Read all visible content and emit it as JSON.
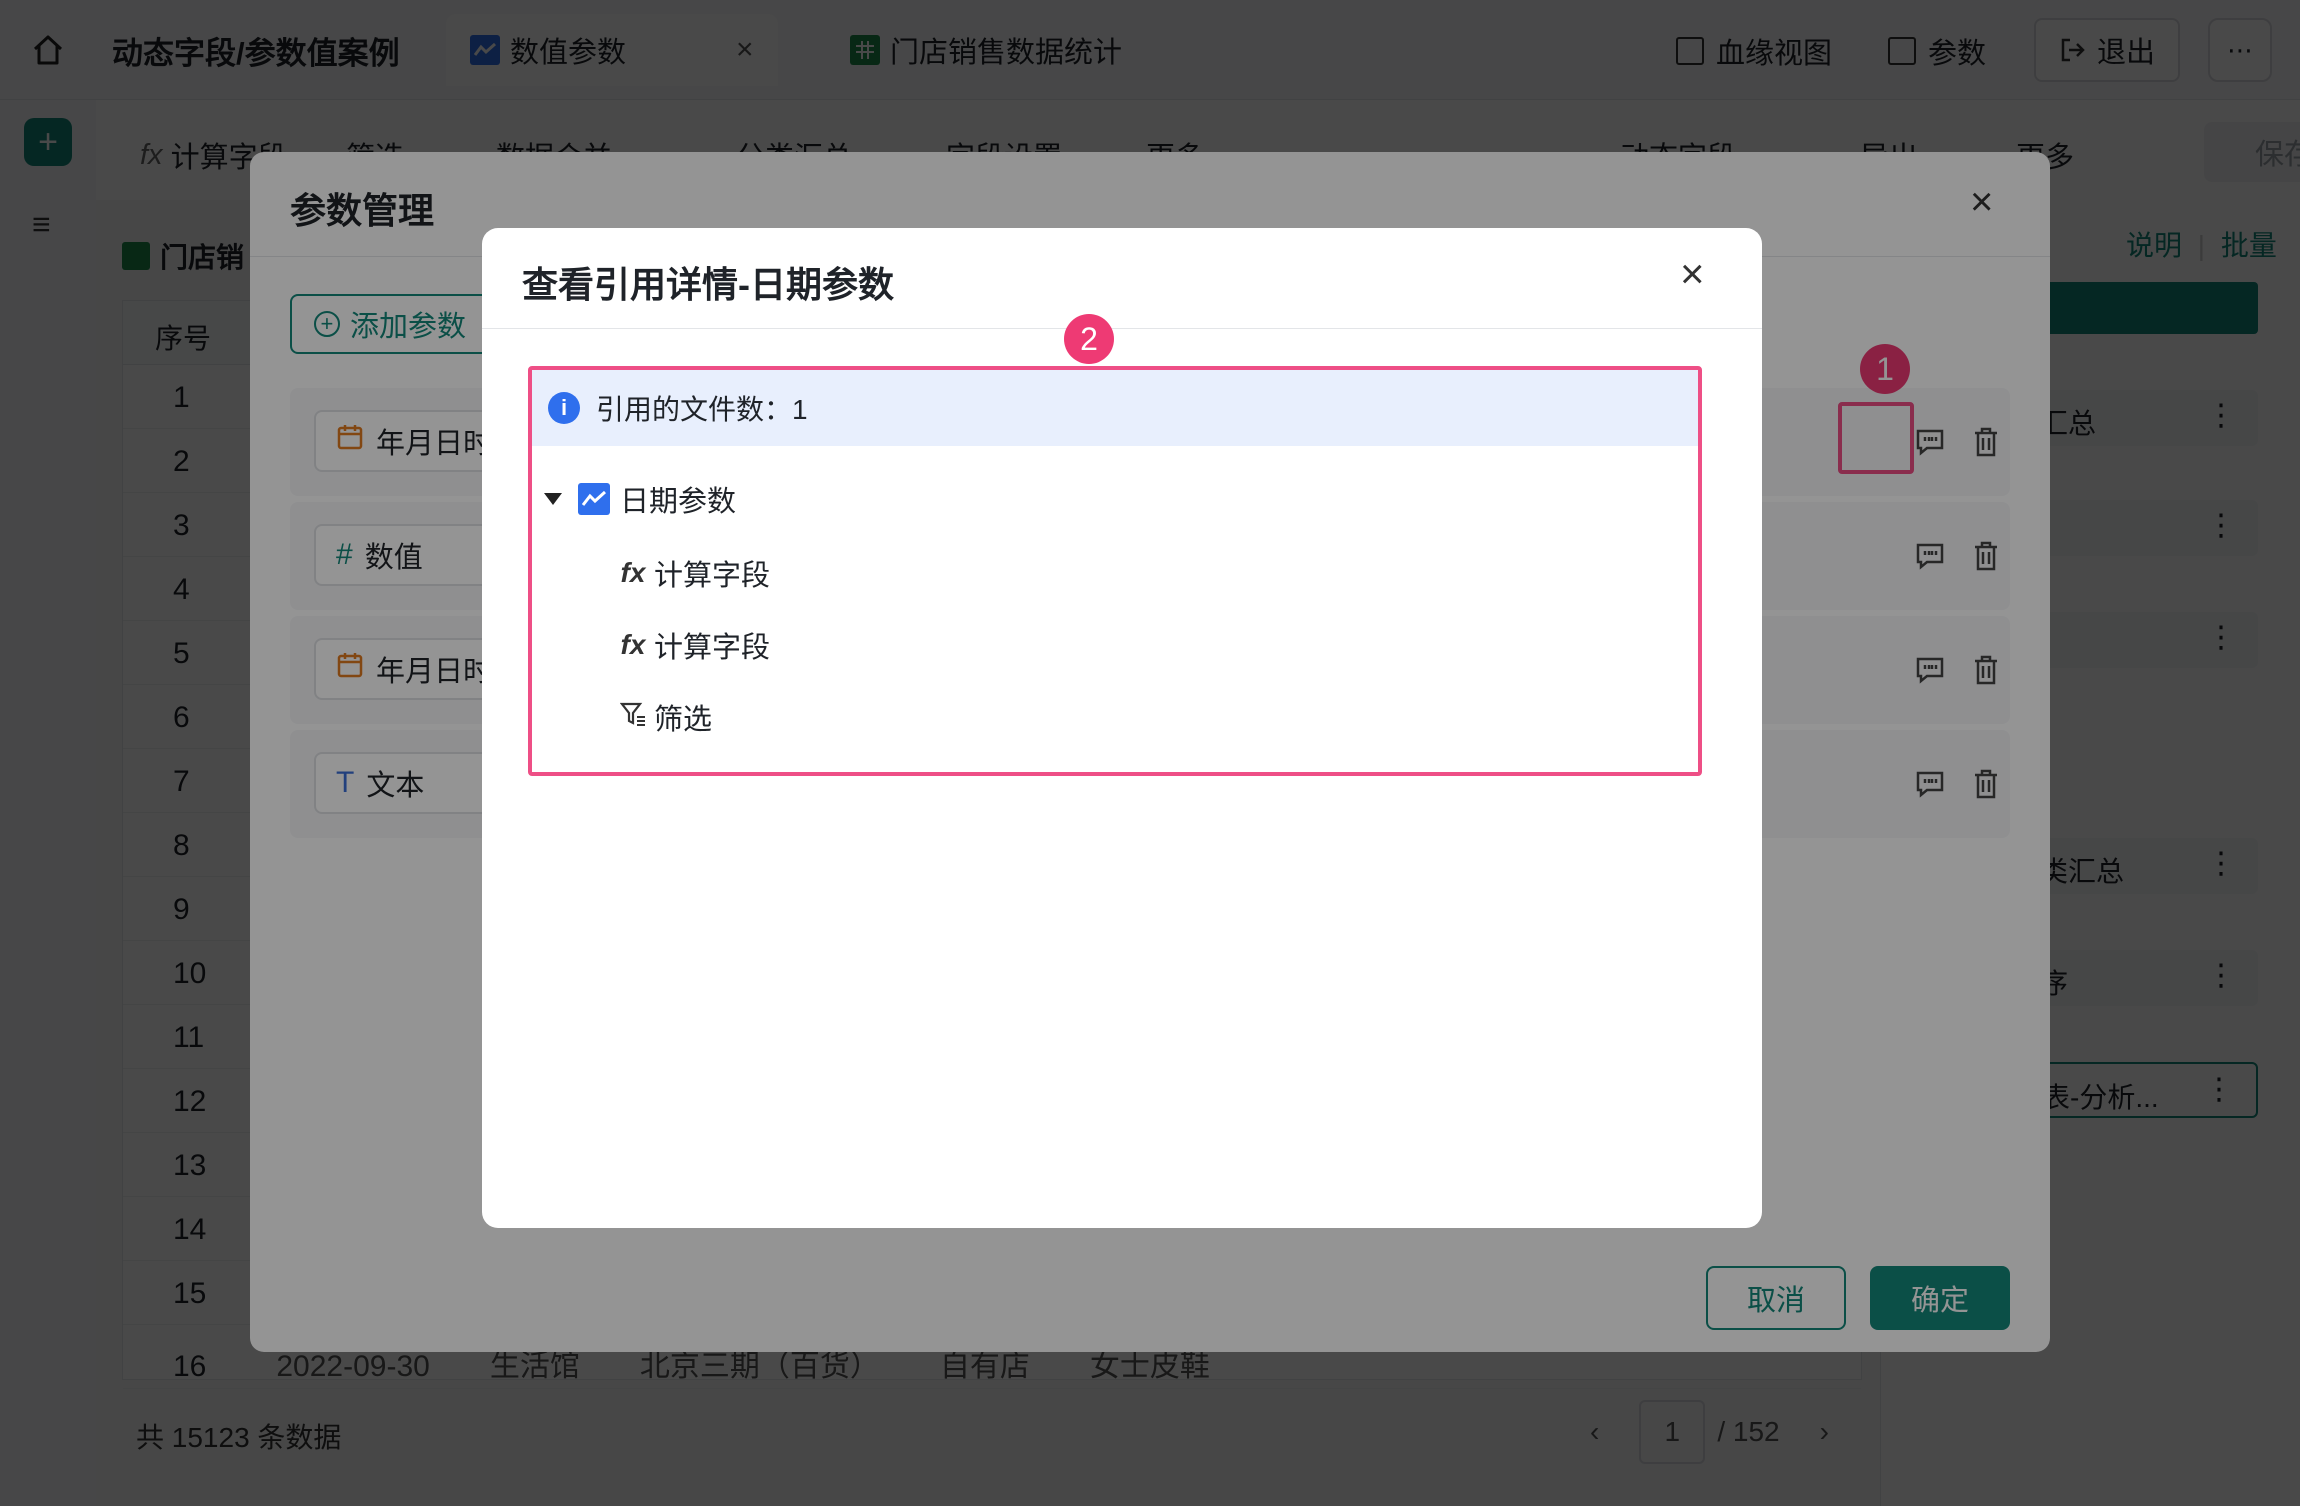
{
  "topbar": {
    "app_title": "动态字段/参数值案例",
    "tabs": [
      {
        "label": "数值参数",
        "close": "×"
      },
      {
        "label": "门店销售数据统计"
      }
    ],
    "right": {
      "lineage_label": "血缘视图",
      "params_label": "参数",
      "logout_label": "退出",
      "more_icon": "⋯"
    }
  },
  "toolbar": {
    "items": [
      "计算字段",
      "筛选",
      "数据合并",
      "分类汇总",
      "字段设置",
      "更多",
      "动态字段",
      "导出",
      "更多"
    ],
    "fx": "fx",
    "save_label": "保存"
  },
  "sheet": {
    "title": "门店销",
    "column_header": "序号",
    "rows": [
      "1",
      "2",
      "3",
      "4",
      "5",
      "6",
      "7",
      "8",
      "9",
      "10",
      "11",
      "12",
      "13",
      "14",
      "15",
      "16"
    ],
    "row16_cells": [
      "2022-09-30",
      "生活馆",
      "北京三期（百货）",
      "自有店",
      "女士皮鞋"
    ],
    "total": "共 15123 条数据",
    "page_current": "1",
    "page_total": "/ 152",
    "prev": "‹",
    "next": "›"
  },
  "side": {
    "links": [
      "说明",
      "批量"
    ],
    "items": [
      "汇总",
      "",
      "",
      "类汇总",
      "序",
      "表-分析..."
    ],
    "dots": "⋮"
  },
  "param_dialog": {
    "title": "参数管理",
    "close": "×",
    "add_label": "添加参数",
    "add_plus": "+",
    "rows": [
      {
        "type_label": "年月日时",
        "type_icon": "calendar-icon"
      },
      {
        "type_label": "数值",
        "type_icon": "hash-icon",
        "glyph": "#"
      },
      {
        "type_label": "年月日时",
        "type_icon": "calendar-icon"
      },
      {
        "type_label": "文本",
        "type_icon": "text-icon",
        "glyph": "T"
      }
    ],
    "cancel_label": "取消",
    "ok_label": "确定",
    "badge_1": "1"
  },
  "ref_dialog": {
    "title": "查看引用详情-日期参数",
    "close": "×",
    "badge_2": "2",
    "info_icon": "i",
    "info_text": "引用的文件数：1",
    "root_label": "日期参数",
    "children": [
      {
        "label": "计算字段",
        "icon": "fx"
      },
      {
        "label": "计算字段",
        "icon": "fx"
      },
      {
        "label": "筛选",
        "icon": "filter"
      }
    ]
  },
  "colors": {
    "accent": "#13887b",
    "highlight": "#ee4f86",
    "info_bg": "#e8effd",
    "info_blue": "#2f6fed"
  }
}
